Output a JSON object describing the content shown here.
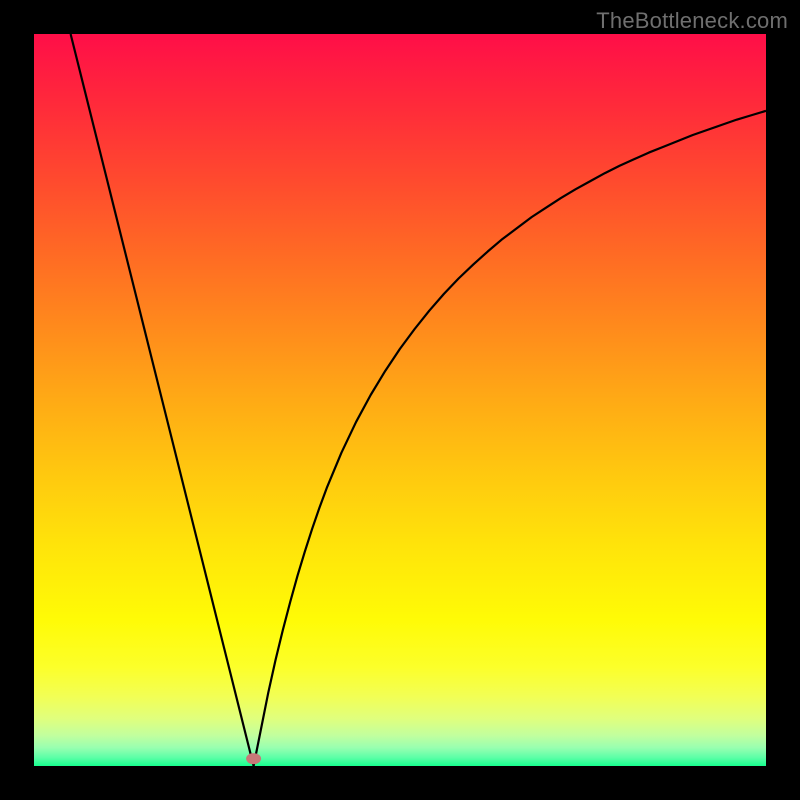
{
  "watermark": "TheBottleneck.com",
  "gradient_stops": [
    {
      "offset": 0.0,
      "color": "#ff0e48"
    },
    {
      "offset": 0.1,
      "color": "#ff2b3a"
    },
    {
      "offset": 0.2,
      "color": "#ff4a2e"
    },
    {
      "offset": 0.3,
      "color": "#ff6a24"
    },
    {
      "offset": 0.4,
      "color": "#ff8a1c"
    },
    {
      "offset": 0.5,
      "color": "#ffaa15"
    },
    {
      "offset": 0.6,
      "color": "#ffc80f"
    },
    {
      "offset": 0.7,
      "color": "#ffe40a"
    },
    {
      "offset": 0.8,
      "color": "#fffb06"
    },
    {
      "offset": 0.865,
      "color": "#fcff2a"
    },
    {
      "offset": 0.905,
      "color": "#f2ff55"
    },
    {
      "offset": 0.935,
      "color": "#e0ff7d"
    },
    {
      "offset": 0.958,
      "color": "#c2ff9e"
    },
    {
      "offset": 0.975,
      "color": "#98ffb0"
    },
    {
      "offset": 0.988,
      "color": "#5effa8"
    },
    {
      "offset": 1.0,
      "color": "#17ff8e"
    }
  ],
  "chart_data": {
    "type": "line",
    "title": "",
    "xlabel": "",
    "ylabel": "",
    "xlim": [
      0,
      100
    ],
    "ylim": [
      0,
      100
    ],
    "optimum_x": 30,
    "marker": {
      "x": 30,
      "y": 1
    },
    "x": [
      5,
      6,
      7,
      8,
      9,
      10,
      11,
      12,
      13,
      14,
      15,
      16,
      17,
      18,
      19,
      20,
      21,
      22,
      23,
      24,
      25,
      26,
      27,
      28,
      29,
      30,
      31,
      32,
      33,
      34,
      35,
      36,
      37,
      38,
      39,
      40,
      42,
      44,
      46,
      48,
      50,
      52,
      54,
      56,
      58,
      60,
      62,
      64,
      66,
      68,
      70,
      72,
      74,
      76,
      78,
      80,
      82,
      84,
      86,
      88,
      90,
      92,
      94,
      96,
      98,
      100
    ],
    "values": [
      100,
      96,
      92,
      88,
      84,
      80,
      76,
      72,
      68,
      64,
      60,
      56,
      52,
      48,
      44,
      40,
      36,
      32,
      28,
      24,
      20,
      16,
      12,
      8,
      4,
      0,
      5,
      10,
      14.5,
      18.6,
      22.4,
      26,
      29.3,
      32.4,
      35.3,
      38,
      42.8,
      47,
      50.7,
      54,
      57,
      59.7,
      62.2,
      64.5,
      66.6,
      68.5,
      70.3,
      72,
      73.5,
      75,
      76.3,
      77.6,
      78.8,
      79.9,
      81,
      82,
      82.9,
      83.8,
      84.6,
      85.4,
      86.2,
      86.9,
      87.6,
      88.3,
      88.9,
      89.5
    ]
  }
}
